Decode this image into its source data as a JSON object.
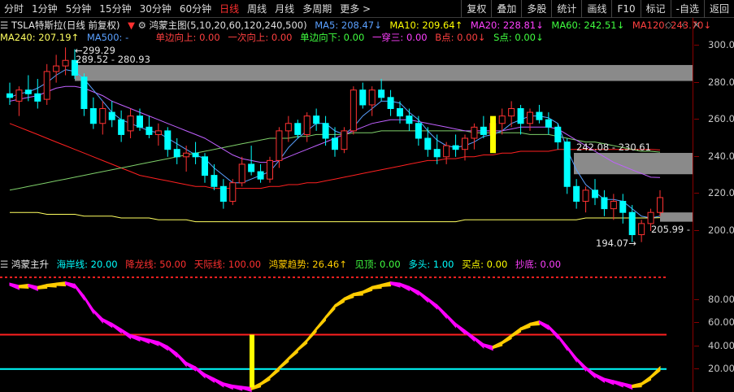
{
  "toolbar": {
    "periods": [
      "分时",
      "1分钟",
      "5分钟",
      "15分钟",
      "30分钟",
      "60分钟",
      "日线",
      "周线",
      "月线",
      "多周期",
      "更多"
    ],
    "active": "日线",
    "more_arrow": ">",
    "right": [
      "复权",
      "叠加",
      "多股",
      "统计",
      "画线",
      "F10",
      "标记",
      "-自选",
      "返回"
    ]
  },
  "info": {
    "stock": "TSLA特斯拉(日线 前复权)",
    "indicator": "鸿蒙主图(5,10,20,60,120,240,500)",
    "ma5": "MA5: 208.47↓",
    "ma10": "MA10: 209.64↑",
    "ma20": "MA20: 228.81↓",
    "ma60": "MA60: 242.51↓",
    "ma120": "MA120: 243.70↓",
    "ma240": "MA240: 207.19↑",
    "ma500": "MA500: -",
    "once_up": "单边向上: 0.00",
    "one_up": "一次向上: 0.00",
    "once_down": "单边向下: 0.00",
    "yichuan": "一穿三: 0.00",
    "bdot": "B点: 0.00↓",
    "sdot": "S点: 0.00↓"
  },
  "sub_info": {
    "name": "鸿蒙主升",
    "haian": "海岸线: 20.00",
    "jianglong": "降龙线: 50.00",
    "tianji": "天际线: 100.00",
    "trend": "鸿蒙趋势: 26.46↑",
    "jianding": "见顶: 0.00",
    "duotou": "多头: 1.00",
    "buy": "买点: 0.00",
    "chaodi": "抄底: 0.00"
  },
  "annotations": {
    "high": "299.29",
    "zone1": "289.52 - 280.93",
    "zone2": "242.08 - 230.61",
    "last": "205.99",
    "low": "194.07"
  },
  "main_axis": [
    "300.0",
    "280.0",
    "260.0",
    "240.0",
    "220.0",
    "200.0"
  ],
  "sub_axis": [
    "80.00",
    "60.00",
    "40.00",
    "20.00"
  ],
  "colors": {
    "up": "#ff3232",
    "down": "#00ffff",
    "ma5": "#ffffff",
    "ma10": "#ffff00",
    "ma20": "#ff00ff",
    "ma60": "#00ff00",
    "ma120": "#ff2020",
    "ma240": "#ffff60",
    "pink": "#ff00ff",
    "gold": "#ffcc00"
  },
  "chart_data": {
    "type": "candlestick",
    "ohlc": [
      [
        274,
        280,
        268,
        272
      ],
      [
        270,
        278,
        262,
        276
      ],
      [
        276,
        284,
        270,
        274
      ],
      [
        274,
        282,
        266,
        270
      ],
      [
        271,
        290,
        268,
        286
      ],
      [
        286,
        295,
        280,
        289
      ],
      [
        289,
        299,
        284,
        292
      ],
      [
        292,
        298,
        282,
        284
      ],
      [
        283,
        285,
        262,
        266
      ],
      [
        266,
        272,
        255,
        258
      ],
      [
        258,
        270,
        252,
        266
      ],
      [
        264,
        270,
        256,
        260
      ],
      [
        260,
        265,
        248,
        252
      ],
      [
        254,
        266,
        250,
        262
      ],
      [
        262,
        266,
        254,
        256
      ],
      [
        256,
        262,
        250,
        252
      ],
      [
        252,
        258,
        246,
        254
      ],
      [
        254,
        256,
        240,
        244
      ],
      [
        244,
        250,
        236,
        240
      ],
      [
        240,
        246,
        232,
        242
      ],
      [
        242,
        248,
        236,
        240
      ],
      [
        240,
        242,
        226,
        230
      ],
      [
        230,
        236,
        222,
        224
      ],
      [
        224,
        228,
        212,
        216
      ],
      [
        216,
        228,
        214,
        226
      ],
      [
        226,
        240,
        224,
        236
      ],
      [
        236,
        246,
        230,
        232
      ],
      [
        232,
        236,
        226,
        228
      ],
      [
        228,
        240,
        226,
        238
      ],
      [
        238,
        256,
        234,
        254
      ],
      [
        254,
        262,
        248,
        258
      ],
      [
        258,
        260,
        250,
        252
      ],
      [
        252,
        264,
        248,
        262
      ],
      [
        262,
        266,
        254,
        258
      ],
      [
        258,
        262,
        246,
        250
      ],
      [
        250,
        256,
        240,
        244
      ],
      [
        244,
        256,
        242,
        254
      ],
      [
        254,
        278,
        252,
        276
      ],
      [
        276,
        280,
        266,
        268
      ],
      [
        268,
        278,
        262,
        276
      ],
      [
        276,
        282,
        270,
        272
      ],
      [
        272,
        276,
        262,
        266
      ],
      [
        266,
        270,
        258,
        262
      ],
      [
        262,
        266,
        254,
        258
      ],
      [
        258,
        262,
        246,
        250
      ],
      [
        250,
        256,
        240,
        244
      ],
      [
        244,
        252,
        236,
        240
      ],
      [
        240,
        248,
        236,
        246
      ],
      [
        246,
        252,
        240,
        244
      ],
      [
        244,
        252,
        238,
        250
      ],
      [
        250,
        258,
        244,
        256
      ],
      [
        256,
        262,
        250,
        252
      ],
      [
        252,
        260,
        246,
        258
      ],
      [
        258,
        266,
        252,
        262
      ],
      [
        262,
        270,
        256,
        266
      ],
      [
        266,
        268,
        252,
        258
      ],
      [
        258,
        266,
        254,
        264
      ],
      [
        264,
        268,
        258,
        260
      ],
      [
        260,
        264,
        252,
        256
      ],
      [
        256,
        258,
        244,
        248
      ],
      [
        248,
        250,
        220,
        224
      ],
      [
        224,
        228,
        212,
        216
      ],
      [
        216,
        224,
        210,
        222
      ],
      [
        222,
        228,
        214,
        218
      ],
      [
        218,
        222,
        208,
        212
      ],
      [
        212,
        220,
        206,
        216
      ],
      [
        216,
        220,
        204,
        210
      ],
      [
        210,
        214,
        194,
        198
      ],
      [
        198,
        206,
        194,
        204
      ],
      [
        204,
        212,
        200,
        210
      ],
      [
        210,
        222,
        208,
        218
      ]
    ],
    "ma5": [
      272,
      274,
      275,
      277,
      280,
      284,
      287,
      286,
      282,
      276,
      270,
      264,
      260,
      258,
      256,
      254,
      253,
      250,
      247,
      244,
      241,
      239,
      234,
      230,
      226,
      226,
      228,
      230,
      232,
      238,
      245,
      250,
      254,
      258,
      258,
      254,
      252,
      256,
      262,
      266,
      270,
      270,
      269,
      264,
      260,
      254,
      249,
      246,
      245,
      246,
      248,
      251,
      252,
      254,
      258,
      260,
      262,
      262,
      261,
      258,
      244,
      233,
      225,
      221,
      217,
      217,
      216,
      212,
      208,
      207,
      208
    ],
    "ma20": [
      270,
      271,
      272,
      273,
      275,
      277,
      278,
      278,
      277,
      275,
      273,
      270,
      268,
      266,
      264,
      262,
      260,
      258,
      256,
      254,
      252,
      250,
      247,
      244,
      241,
      239,
      238,
      237,
      237,
      238,
      240,
      242,
      244,
      246,
      248,
      250,
      252,
      254,
      256,
      258,
      259,
      260,
      260,
      260,
      259,
      258,
      257,
      256,
      255,
      254,
      254,
      254,
      254,
      254,
      255,
      256,
      256,
      256,
      256,
      255,
      252,
      249,
      246,
      243,
      240,
      237,
      235,
      233,
      231,
      229,
      228.8
    ],
    "ma60": [
      222,
      223,
      224,
      225,
      226,
      227,
      228,
      229,
      230,
      231,
      232,
      233,
      234,
      235,
      236,
      237,
      238,
      239,
      240,
      241,
      242,
      243,
      244,
      245,
      246,
      247,
      248,
      249,
      250,
      250,
      250,
      251,
      251,
      252,
      252,
      252,
      252,
      253,
      253,
      253,
      254,
      254,
      254,
      254,
      254,
      254,
      254,
      254,
      254,
      254,
      253,
      253,
      253,
      253,
      253,
      253,
      252,
      252,
      252,
      251,
      250,
      249,
      248,
      248,
      247,
      246,
      245,
      244,
      243,
      243,
      242.5
    ],
    "ma120": [
      258,
      256,
      254,
      252,
      250,
      248,
      246,
      244,
      242,
      240,
      238,
      236,
      234,
      232,
      230,
      229,
      228,
      227,
      226,
      225,
      224,
      224,
      223,
      223,
      223,
      223,
      223,
      223,
      224,
      224,
      225,
      225,
      226,
      226,
      227,
      228,
      229,
      230,
      231,
      232,
      233,
      234,
      235,
      236,
      237,
      238,
      238,
      239,
      239,
      240,
      240,
      241,
      241,
      242,
      242,
      243,
      243,
      243,
      243,
      244,
      244,
      244,
      244,
      244,
      244,
      244,
      244,
      244,
      244,
      244,
      243.7
    ],
    "ma240": [
      210,
      210,
      210,
      210,
      209,
      209,
      209,
      209,
      208,
      208,
      208,
      208,
      207,
      207,
      207,
      207,
      206,
      206,
      206,
      206,
      205,
      205,
      205,
      205,
      205,
      205,
      205,
      205,
      205,
      205,
      205,
      205,
      205,
      205,
      205,
      205,
      205,
      205,
      205,
      205,
      205,
      205,
      205,
      205,
      205,
      205,
      205,
      205,
      205,
      206,
      206,
      206,
      206,
      206,
      206,
      206,
      206,
      206,
      206,
      206,
      206,
      206,
      207,
      207,
      207,
      207,
      207,
      207,
      207,
      207,
      207.2
    ],
    "oscillator": [
      95,
      93,
      94,
      92,
      94,
      95,
      96,
      94,
      84,
      72,
      64,
      60,
      55,
      50,
      48,
      46,
      44,
      40,
      34,
      26,
      22,
      16,
      12,
      8,
      6,
      5,
      4,
      8,
      14,
      22,
      30,
      38,
      46,
      56,
      66,
      76,
      82,
      86,
      88,
      92,
      94,
      96,
      95,
      92,
      88,
      82,
      76,
      68,
      60,
      54,
      48,
      42,
      40,
      44,
      50,
      56,
      60,
      62,
      58,
      50,
      40,
      30,
      22,
      16,
      12,
      10,
      8,
      6,
      8,
      14,
      22
    ],
    "lines": {
      "haian": 20,
      "jianglong": 50,
      "tianji": 100
    }
  }
}
